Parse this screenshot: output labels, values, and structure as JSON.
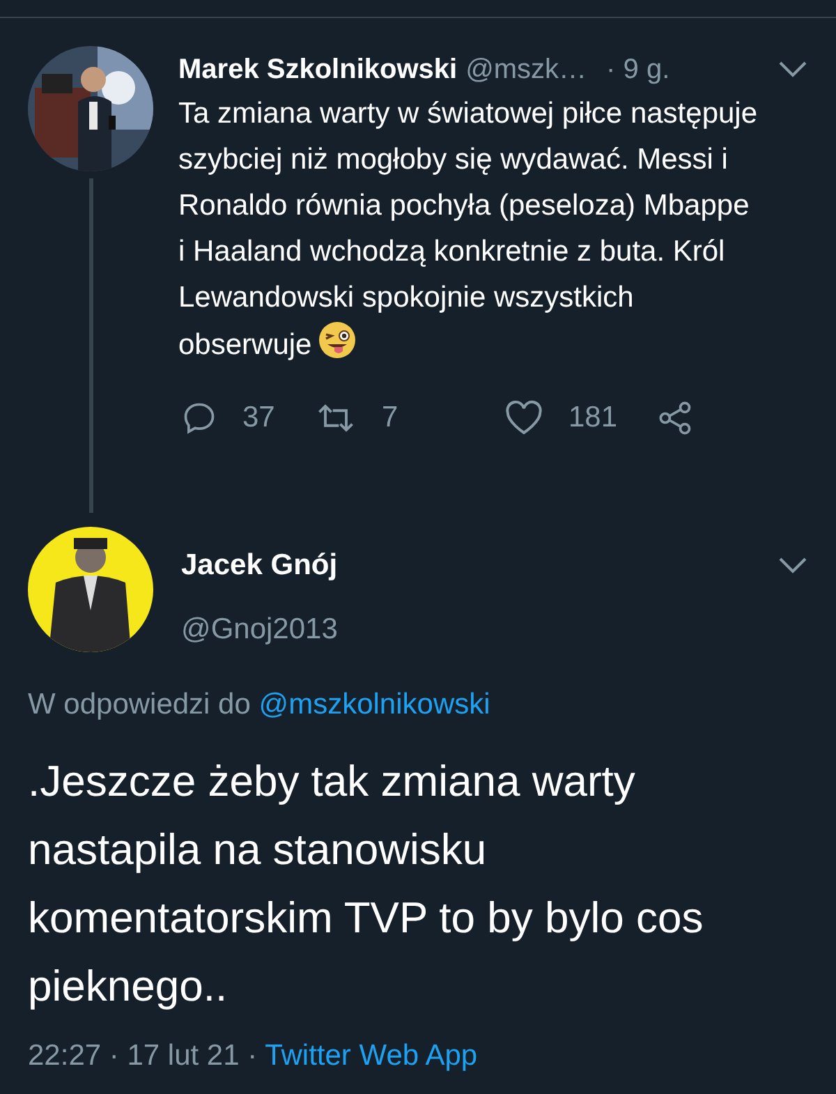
{
  "thread": {
    "author": "Marek Szkolnikowski",
    "handle": "@mszk…",
    "time": "· 9 g.",
    "text": "Ta zmiana warty w światowej piłce następuje szybciej niż mogłoby się wydawać. Messi i Ronaldo równia pochyła (peseloza) Mbappe i Haaland wchodzą konkretnie z buta. Król Lewandowski spokojnie wszystkich obserwuje",
    "stats": [
      {
        "kind": "reply",
        "count": "37"
      },
      {
        "kind": "retweet",
        "count": "7"
      },
      {
        "kind": "like",
        "count": "181"
      },
      {
        "kind": "share"
      }
    ]
  },
  "tweet": {
    "author": "Jacek Gnój",
    "handle": "@Gnoj2013",
    "reply_prefix": "W odpowiedzi do",
    "reply_to": "@mszkolnikowski",
    "text": ".Jeszcze żeby tak zmiana warty nastapila na stanowisku komentatorskim TVP to by bylo cos pieknego..",
    "timestamp": "22:27 · 17 lut 21 ·",
    "source": "Twitter Web App"
  }
}
